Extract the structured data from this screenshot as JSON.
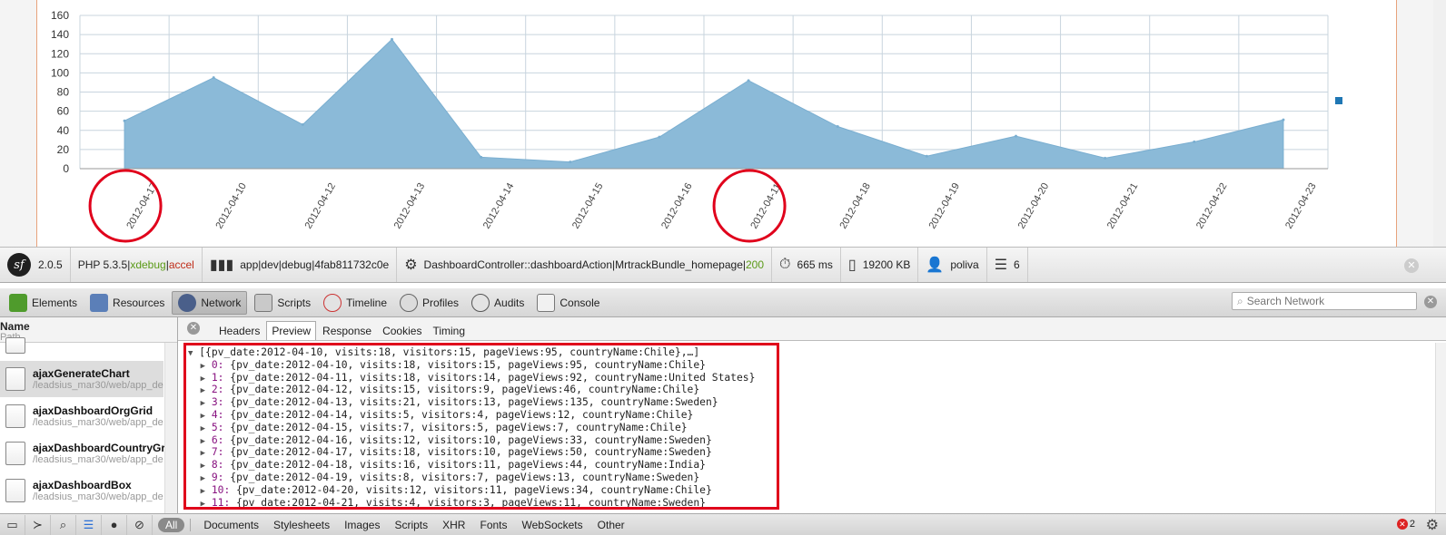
{
  "chart_data": {
    "type": "area",
    "categories": [
      "2012-04-17",
      "2012-04-10",
      "2012-04-12",
      "2012-04-13",
      "2012-04-14",
      "2012-04-15",
      "2012-04-16",
      "2012-04-11",
      "2012-04-18",
      "2012-04-19",
      "2012-04-20",
      "2012-04-21",
      "2012-04-22",
      "2012-04-23"
    ],
    "values": [
      50,
      95,
      46,
      135,
      12,
      7,
      33,
      92,
      44,
      13,
      34,
      11,
      28,
      51
    ],
    "yticks": [
      "160",
      "140",
      "120",
      "100",
      "80",
      "60",
      "40",
      "20",
      "0"
    ],
    "ylim": [
      0,
      160
    ],
    "grid": true,
    "color": "#8bbad8",
    "highlight_circles_on": [
      "2012-04-17",
      "2012-04-11"
    ],
    "highlight_color": "#e0001b"
  },
  "sf_toolbar": {
    "version": "2.0.5",
    "php": "PHP 5.3.5",
    "xdebug": "xdebug",
    "accel": "accel",
    "env": "app|dev|debug|4fab811732c0e",
    "controller": "DashboardController::dashboardAction|MrtrackBundle_homepage|",
    "status": "200",
    "time": "665 ms",
    "memory": "19200 KB",
    "user": "poliva",
    "queries": "6"
  },
  "devtools": {
    "tabs": [
      {
        "label": "Elements",
        "icon": "elements-icon"
      },
      {
        "label": "Resources",
        "icon": "resources-icon"
      },
      {
        "label": "Network",
        "icon": "network-icon"
      },
      {
        "label": "Scripts",
        "icon": "scripts-icon"
      },
      {
        "label": "Timeline",
        "icon": "timeline-icon"
      },
      {
        "label": "Profiles",
        "icon": "profiles-icon"
      },
      {
        "label": "Audits",
        "icon": "audits-icon"
      },
      {
        "label": "Console",
        "icon": "console-icon"
      }
    ],
    "search_placeholder": "Search Network"
  },
  "requests": {
    "header_name": "Name",
    "header_path": "Path",
    "items": [
      {
        "name": "ajaxGenerateChart",
        "path": "/leadsius_mar30/web/app_de"
      },
      {
        "name": "ajaxDashboardOrgGrid",
        "path": "/leadsius_mar30/web/app_de"
      },
      {
        "name": "ajaxDashboardCountryGric",
        "path": "/leadsius_mar30/web/app_de"
      },
      {
        "name": "ajaxDashboardBox",
        "path": "/leadsius_mar30/web/app_de"
      }
    ]
  },
  "preview": {
    "tabs": [
      "Headers",
      "Preview",
      "Response",
      "Cookies",
      "Timing"
    ],
    "summary": "[{pv_date:2012-04-10, visits:18, visitors:15, pageViews:95, countryName:Chile},…]",
    "rows": [
      {
        "idx": "0:",
        "text": "{pv_date:2012-04-10, visits:18, visitors:15, pageViews:95, countryName:Chile}"
      },
      {
        "idx": "1:",
        "text": "{pv_date:2012-04-11, visits:18, visitors:14, pageViews:92, countryName:United States}"
      },
      {
        "idx": "2:",
        "text": "{pv_date:2012-04-12, visits:15, visitors:9, pageViews:46, countryName:Chile}"
      },
      {
        "idx": "3:",
        "text": "{pv_date:2012-04-13, visits:21, visitors:13, pageViews:135, countryName:Sweden}"
      },
      {
        "idx": "4:",
        "text": "{pv_date:2012-04-14, visits:5, visitors:4, pageViews:12, countryName:Chile}"
      },
      {
        "idx": "5:",
        "text": "{pv_date:2012-04-15, visits:7, visitors:5, pageViews:7, countryName:Chile}"
      },
      {
        "idx": "6:",
        "text": "{pv_date:2012-04-16, visits:12, visitors:10, pageViews:33, countryName:Sweden}"
      },
      {
        "idx": "7:",
        "text": "{pv_date:2012-04-17, visits:18, visitors:10, pageViews:50, countryName:Sweden}"
      },
      {
        "idx": "8:",
        "text": "{pv_date:2012-04-18, visits:16, visitors:11, pageViews:44, countryName:India}"
      },
      {
        "idx": "9:",
        "text": "{pv_date:2012-04-19, visits:8, visitors:7, pageViews:13, countryName:Sweden}"
      },
      {
        "idx": "10:",
        "text": "{pv_date:2012-04-20, visits:12, visitors:11, pageViews:34, countryName:Chile}"
      },
      {
        "idx": "11:",
        "text": "{pv_date:2012-04-21, visits:4, visitors:3, pageViews:11, countryName:Sweden}"
      }
    ]
  },
  "statusbar": {
    "filters": [
      "All",
      "Documents",
      "Stylesheets",
      "Images",
      "Scripts",
      "XHR",
      "Fonts",
      "WebSockets",
      "Other"
    ],
    "error_count": "2"
  }
}
